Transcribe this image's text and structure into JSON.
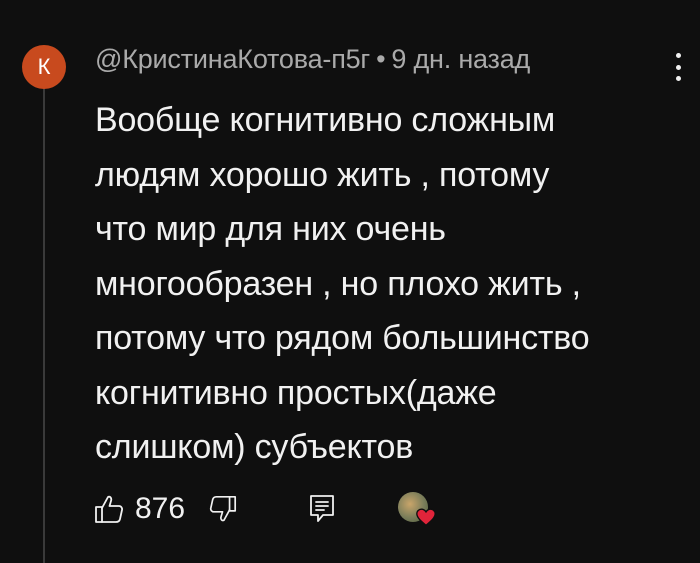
{
  "comment": {
    "avatar_letter": "К",
    "author": "@КристинаКотова-п5г",
    "separator": "•",
    "time": "9 дн. назад",
    "text": "Вообще когнитивно сложным\nлюдям хорошо жить , потому\nчто мир для них очень\nмногообразен , но плохо жить ,\nпотому что рядом большинство\nкогнитивно простых(даже\nслишком) субъектов"
  },
  "actions": {
    "like_count": "876"
  },
  "colors": {
    "background": "#0f0f0f",
    "avatar": "#c84a1e",
    "meta_text": "#aaaaaa",
    "heart": "#e0243a"
  },
  "icons": [
    "more-options-icon",
    "thumbs-up-icon",
    "thumbs-down-icon",
    "reply-icon",
    "creator-heart-icon"
  ]
}
